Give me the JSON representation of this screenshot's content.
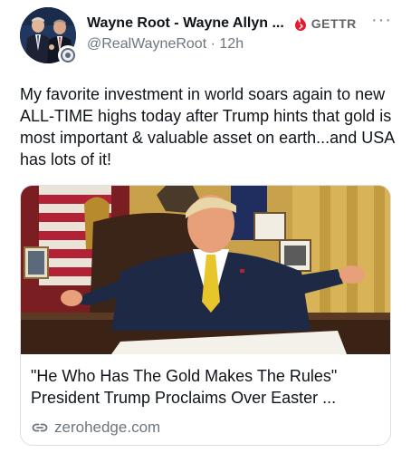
{
  "post": {
    "author": {
      "display_name": "Wayne Root - Wayne Allyn ...",
      "handle": "@RealWayneRoot",
      "time": "12h",
      "avatar": "author-avatar",
      "verified_badge": "badge-icon"
    },
    "platform": {
      "label": "GETTR",
      "icon": "gettr-icon",
      "color": "#e31b2d"
    },
    "more_icon": "more-horizontal-icon",
    "text": "My favorite investment in world soars again to new ALL-TIME highs today after Trump hints that gold is most important & valuable asset on earth...and USA has lots of it!",
    "link_card": {
      "image": "article-thumbnail",
      "title": "\"He Who Has The Gold Makes The Rules\" President Trump Proclaims Over Easter ...",
      "domain": "zerohedge.com",
      "link_icon": "link-icon"
    }
  }
}
